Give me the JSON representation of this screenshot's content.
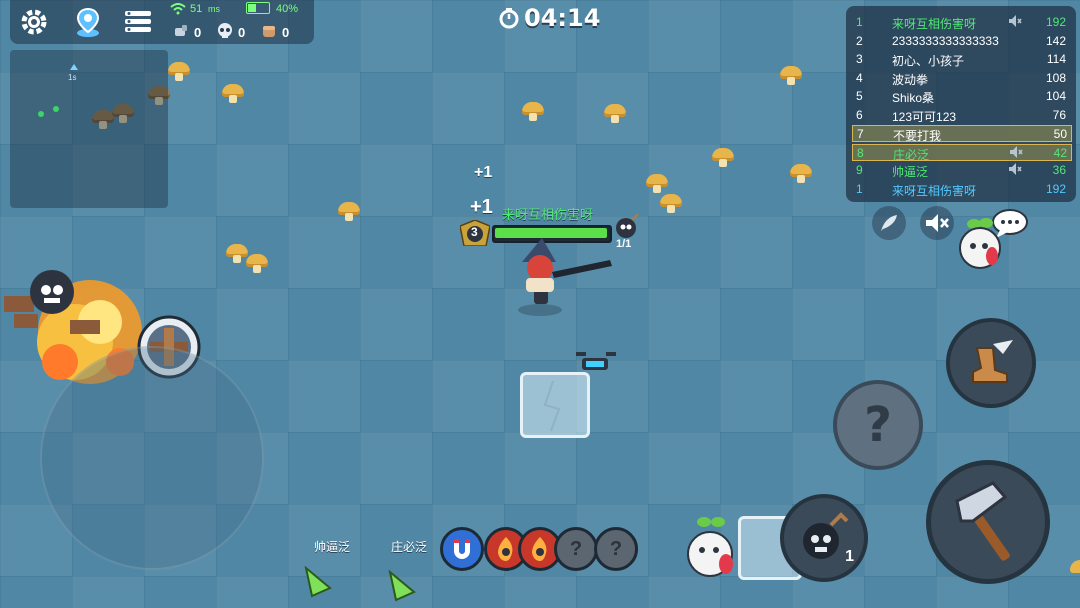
{
  "hud": {
    "timer": "04:14",
    "ping": "51",
    "ping_unit": "ms",
    "battery": "40%",
    "battery_level": 0.4,
    "counters": [
      "0",
      "0",
      "0"
    ]
  },
  "scoreboard": [
    {
      "rank": "1",
      "name": "来呀互相伤害呀",
      "score": "192",
      "style": "green",
      "muted": true
    },
    {
      "rank": "2",
      "name": "2333333333333333",
      "score": "142",
      "style": "",
      "muted": false
    },
    {
      "rank": "3",
      "name": "初心、小孩子",
      "score": "114",
      "style": "",
      "muted": false
    },
    {
      "rank": "4",
      "name": "波动拳",
      "score": "108",
      "style": "",
      "muted": false
    },
    {
      "rank": "5",
      "name": "Shiko桑",
      "score": "104",
      "style": "",
      "muted": false
    },
    {
      "rank": "6",
      "name": "123可可123",
      "score": "76",
      "style": "",
      "muted": false
    },
    {
      "rank": "7",
      "name": "不要打我",
      "score": "50",
      "style": "gold",
      "muted": false
    },
    {
      "rank": "8",
      "name": "庄必泛",
      "score": "42",
      "style": "goldgreen",
      "muted": true
    },
    {
      "rank": "9",
      "name": "帅逼泛",
      "score": "36",
      "style": "green",
      "muted": true
    },
    {
      "rank": "1",
      "name": "来呀互相伤害呀",
      "score": "192",
      "style": "self",
      "muted": false
    }
  ],
  "player": {
    "name": "来呀互相伤害呀",
    "level": "3",
    "health": 1.0,
    "float_text_1": "+1",
    "float_text_2": "+1"
  },
  "enemy_tag": "1/1",
  "teammates": [
    "帅逼泛",
    "庄必泛"
  ],
  "abilities": [
    {
      "icon": "magnet-icon",
      "color": "#2f6fd6"
    },
    {
      "icon": "fire-demon-icon",
      "color": "#c8382a"
    },
    {
      "icon": "flame-claw-icon",
      "color": "#c8382a"
    },
    {
      "icon": "unknown-ability-icon",
      "color": "#5b6670",
      "label": "?"
    },
    {
      "icon": "unknown-ability-icon",
      "color": "#5b6670",
      "label": "?"
    }
  ],
  "mystery_button_label": "?",
  "bomb_count": "1"
}
